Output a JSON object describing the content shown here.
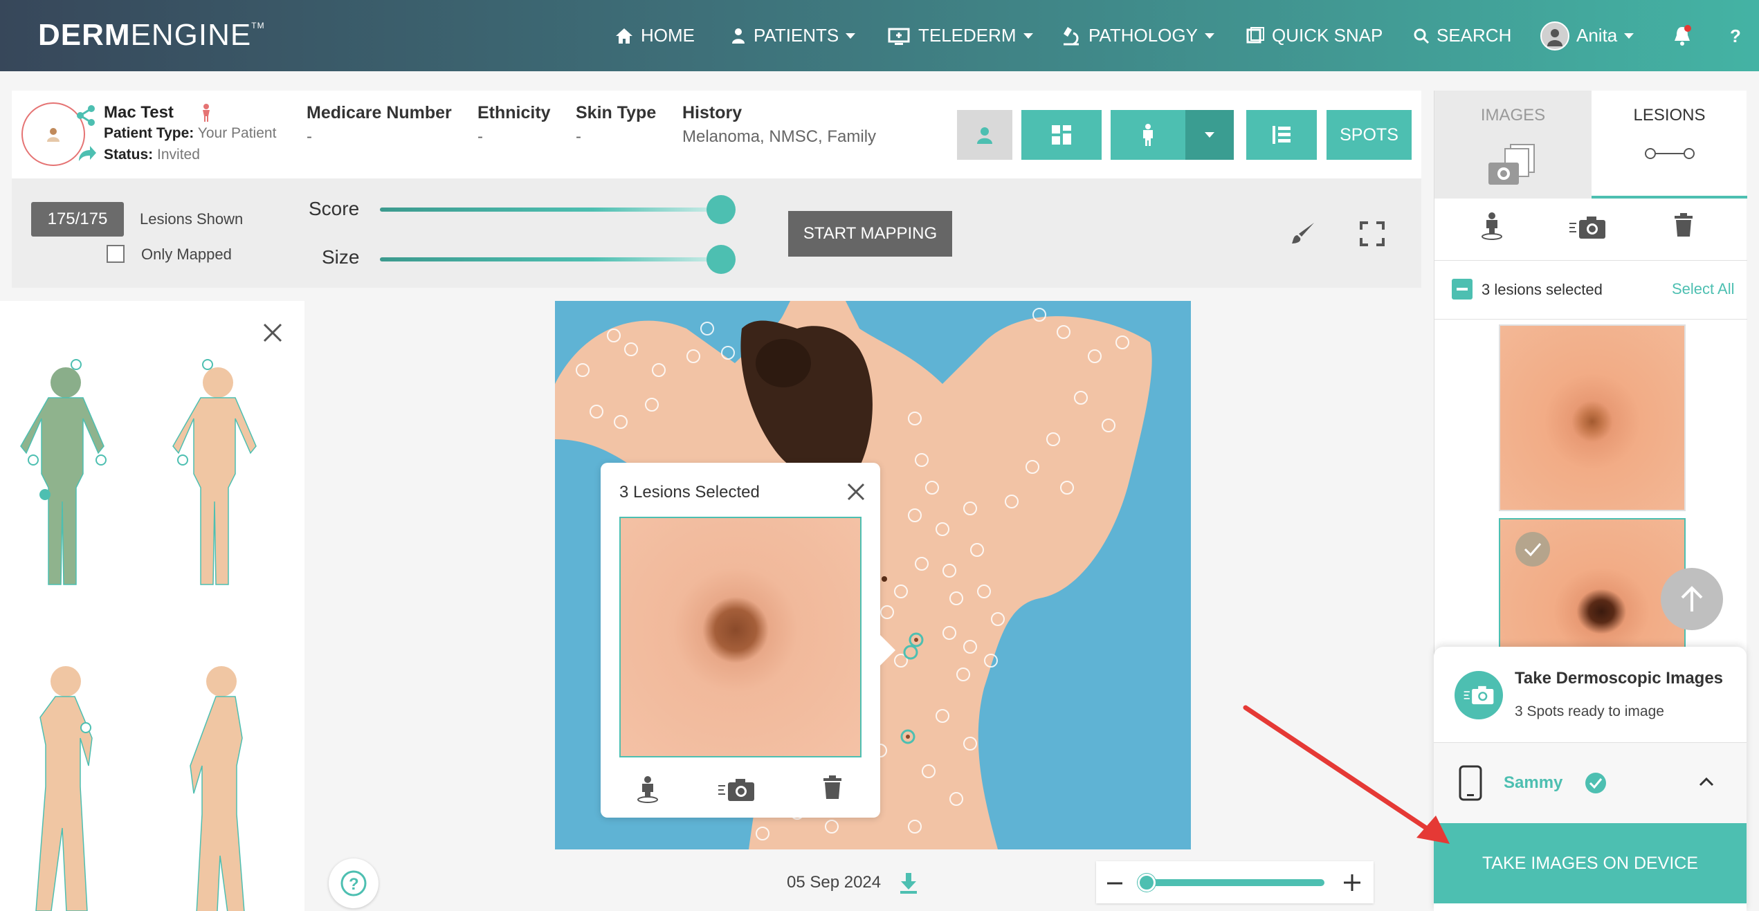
{
  "brand": {
    "logo_bold": "DERM",
    "logo_light": "ENGINE",
    "tm": "TM"
  },
  "nav": {
    "home": "HOME",
    "patients": "PATIENTS",
    "telederm": "TELEDERM",
    "pathology": "PATHOLOGY",
    "quick_snap": "QUICK SNAP",
    "search": "SEARCH",
    "user": "Anita"
  },
  "patient": {
    "name": "Mac Test",
    "type_label": "Patient Type:",
    "type_value": "Your Patient",
    "status_label": "Status:",
    "status_value": "Invited",
    "medicare_label": "Medicare Number",
    "medicare_value": "-",
    "ethnicity_label": "Ethnicity",
    "ethnicity_value": "-",
    "skin_label": "Skin Type",
    "skin_value": "-",
    "history_label": "History",
    "history_value": "Melanoma, NMSC, Family",
    "spots_label": "SPOTS"
  },
  "controls": {
    "count": "175/175",
    "lesions_shown": "Lesions Shown",
    "only_mapped": "Only Mapped",
    "score_label": "Score",
    "size_label": "Size",
    "start_mapping": "START MAPPING",
    "score_fraction": 1.0,
    "size_fraction": 1.0
  },
  "popup": {
    "title": "3 Lesions Selected"
  },
  "footer": {
    "date": "05 Sep 2024",
    "zoom_fraction": 0.0
  },
  "right": {
    "tab_images": "IMAGES",
    "tab_lesions": "LESIONS",
    "selected_text": "3 lesions selected",
    "select_all": "Select All",
    "card_title": "Take Dermoscopic Images",
    "card_sub": "3 Spots ready to image",
    "device_name": "Sammy",
    "take_btn": "TAKE IMAGES ON DEVICE"
  },
  "colors": {
    "accent": "#4dbfb1",
    "nav_dark": "#37475a",
    "annotation_arrow": "#e53935"
  }
}
